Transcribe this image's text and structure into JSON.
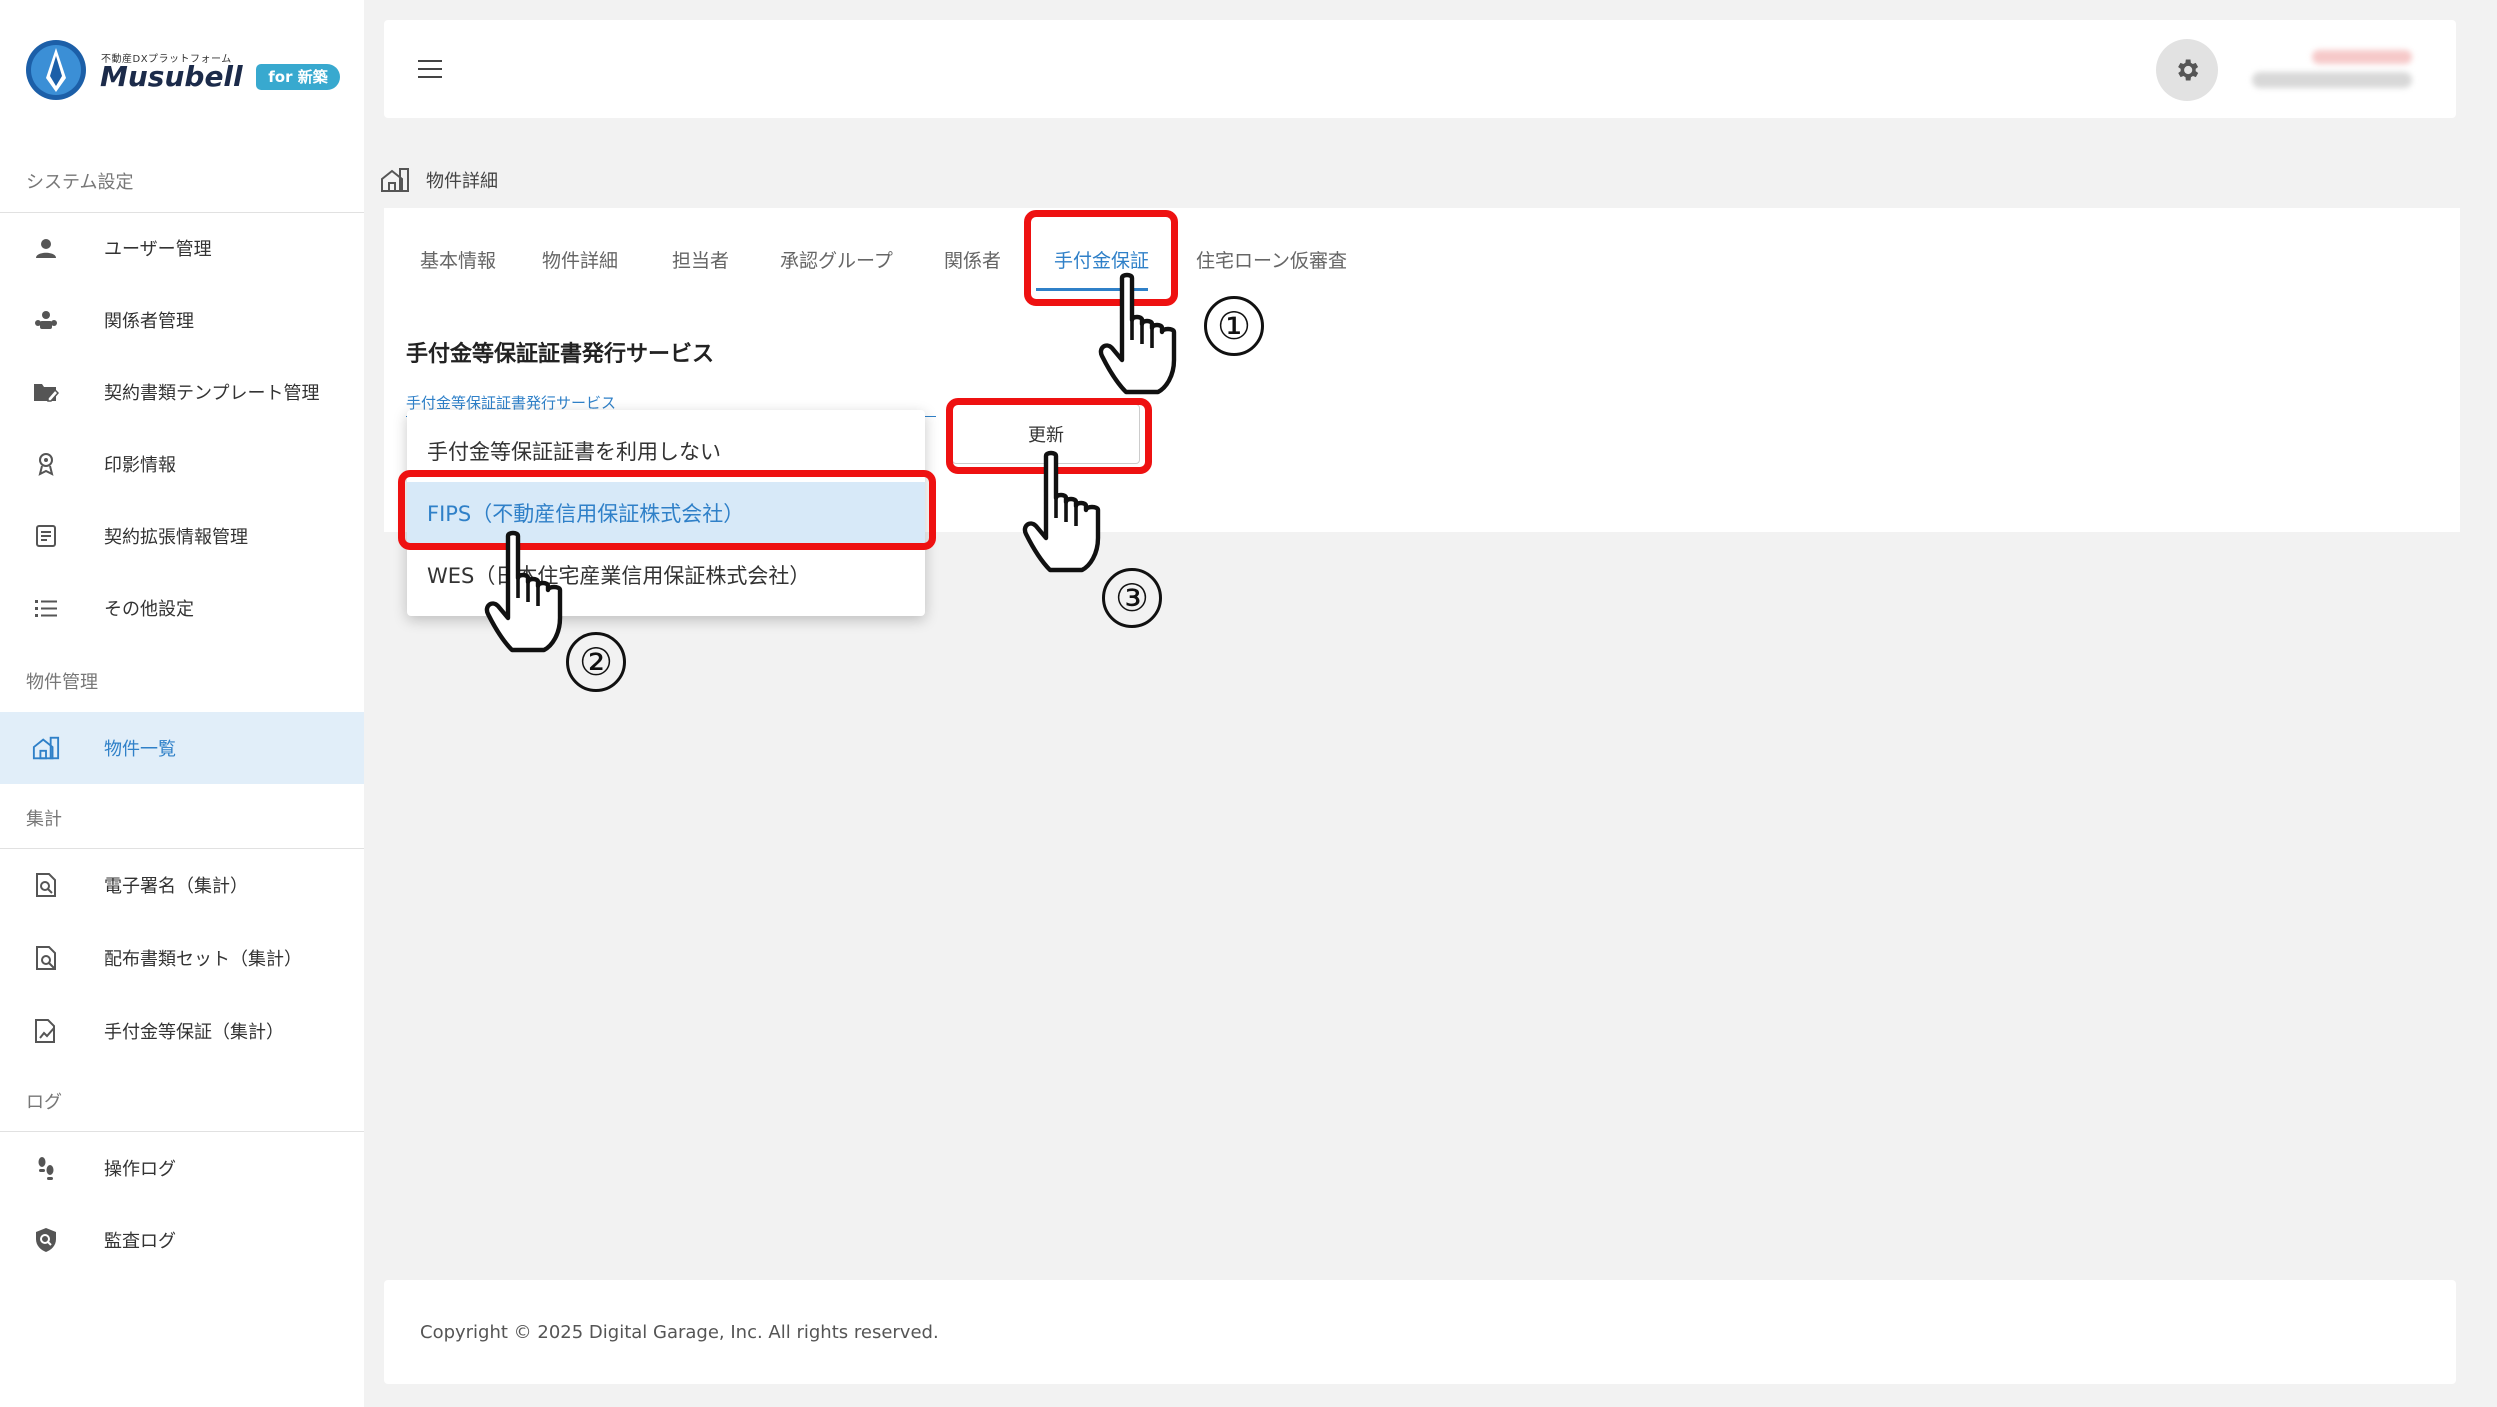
{
  "brand": {
    "tagline": "不動産DXプラットフォーム",
    "name": "Musubell",
    "badge": "for 新築",
    "accent_color": "#38a9cf"
  },
  "sidebar": {
    "sections": [
      {
        "label": "システム設定",
        "items": [
          {
            "label": "ユーザー管理",
            "icon": "person-icon"
          },
          {
            "label": "関係者管理",
            "icon": "people-icon"
          },
          {
            "label": "契約書類テンプレート管理",
            "icon": "folder-edit-icon"
          },
          {
            "label": "印影情報",
            "icon": "seal-icon"
          },
          {
            "label": "契約拡張情報管理",
            "icon": "document-list-icon"
          },
          {
            "label": "その他設定",
            "icon": "list-icon"
          }
        ]
      },
      {
        "label": "物件管理",
        "items": [
          {
            "label": "物件一覧",
            "icon": "building-icon",
            "active": true
          }
        ]
      },
      {
        "label": "集計",
        "items": [
          {
            "label": "電子署名（集計）",
            "icon": "doc-search-icon"
          },
          {
            "label": "配布書類セット（集計）",
            "icon": "doc-magnify-icon"
          },
          {
            "label": "手付金等保証（集計）",
            "icon": "doc-chart-icon"
          }
        ]
      },
      {
        "label": "ログ",
        "items": [
          {
            "label": "操作ログ",
            "icon": "footsteps-icon"
          },
          {
            "label": "監査ログ",
            "icon": "shield-search-icon"
          }
        ]
      }
    ]
  },
  "header": {
    "menu_icon": "hamburger-icon",
    "settings_icon": "gear-icon"
  },
  "breadcrumb": {
    "icon": "building-icon",
    "label": "物件詳細"
  },
  "tabs": [
    {
      "label": "基本情報"
    },
    {
      "label": "物件詳細"
    },
    {
      "label": "担当者"
    },
    {
      "label": "承認グループ"
    },
    {
      "label": "関係者"
    },
    {
      "label": "手付金保証",
      "active": true
    },
    {
      "label": "住宅ローン仮審査"
    }
  ],
  "content": {
    "section_title": "手付金等保証証書発行サービス",
    "field_label": "手付金等保証証書発行サービス",
    "update_button": "更新",
    "dropdown": {
      "options": [
        {
          "label": "手付金等保証証書を利用しない"
        },
        {
          "label": "FIPS（不動産信用保証株式会社）",
          "selected": true
        },
        {
          "label": "WES（日本住宅産業信用保証株式会社）"
        }
      ]
    }
  },
  "annotations": {
    "steps": [
      "①",
      "②",
      "③"
    ],
    "highlight_color": "#ee1111"
  },
  "footer": {
    "copyright": "Copyright © 2025 Digital Garage, Inc. All rights reserved."
  }
}
